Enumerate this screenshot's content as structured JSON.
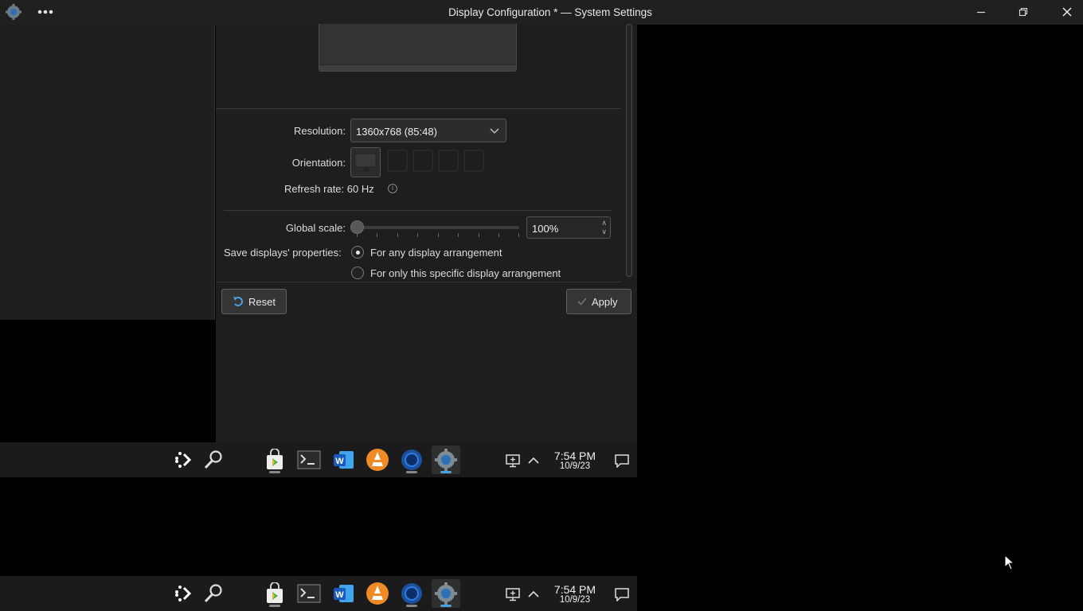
{
  "window": {
    "title": "Display Configuration * — System Settings"
  },
  "display": {
    "resolution_label": "Resolution:",
    "resolution_value": "1360x768 (85:48)",
    "orientation_label": "Orientation:",
    "refresh_rate_text": "Refresh rate: 60 Hz",
    "global_scale_label": "Global scale:",
    "global_scale_value": "100%",
    "global_scale_level_percent": 100,
    "save_label": "Save displays' properties:",
    "save_options": [
      {
        "label": "For any display arrangement",
        "checked": true
      },
      {
        "label": "For only this specific display arrangement",
        "checked": false
      }
    ]
  },
  "buttons": {
    "reset": "Reset",
    "apply": "Apply"
  },
  "taskbar": {
    "apps": [
      "launcher-icon",
      "search-icon",
      "store-icon",
      "terminal-icon",
      "word-icon",
      "vlc-icon",
      "browser-icon",
      "settings-icon"
    ],
    "time": "7:54 PM",
    "date": "10/9/23"
  },
  "colors": {
    "accent": "#4aa3df",
    "window_bg": "#1e1e1e",
    "titlebar_bg": "#202020"
  }
}
